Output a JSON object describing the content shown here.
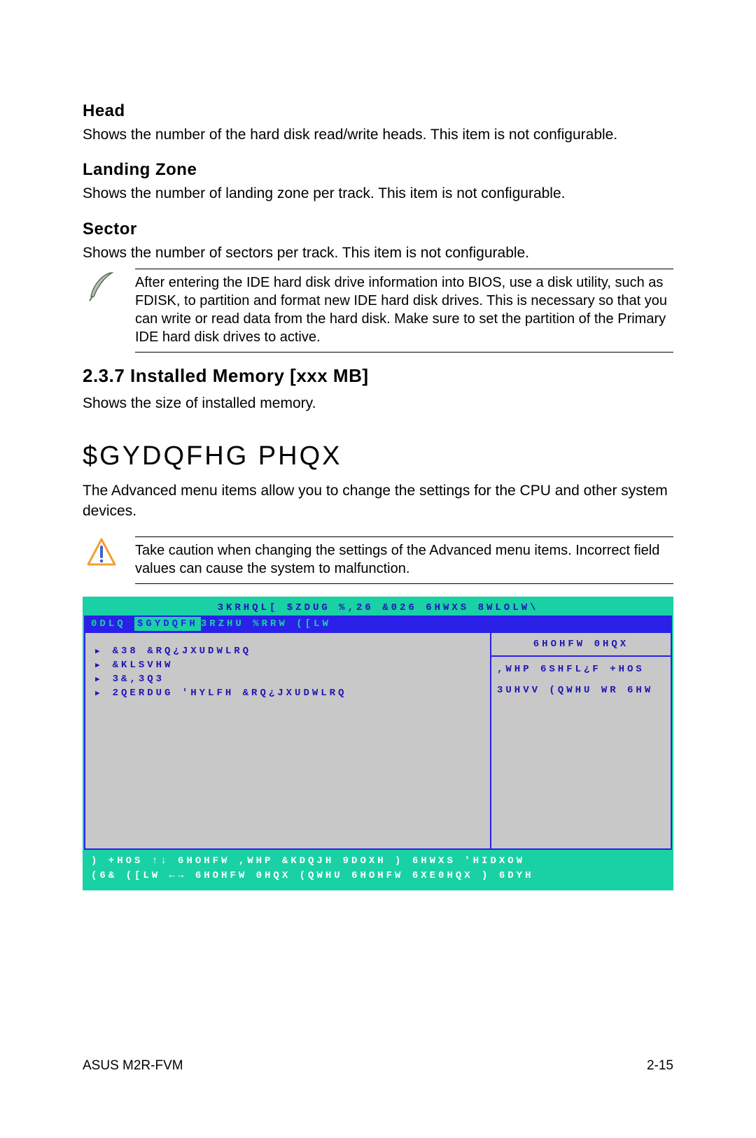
{
  "sections": {
    "head": {
      "title": "Head",
      "body": "Shows the number of the hard disk read/write heads. This item is not configurable."
    },
    "landing": {
      "title": "Landing Zone",
      "body": "Shows the number of landing zone per track. This item is not configurable."
    },
    "sector": {
      "title": "Sector",
      "body": "Shows the number of sectors per track. This item is not configurable."
    }
  },
  "note1": "After entering the IDE hard disk drive information into BIOS, use a disk utility, such as FDISK, to partition and format new IDE hard disk drives. This is necessary so that you can write or read data from the hard disk. Make sure to set the partition of the Primary IDE hard disk drives to active.",
  "memory": {
    "title": "2.3.7  Installed Memory [xxx MB]",
    "body": "Shows the size of installed memory."
  },
  "advanced": {
    "title": "$GYDQFHG PHQX",
    "body": "The Advanced menu items allow you to change the settings for the CPU and other system devices."
  },
  "note2": "Take caution when changing the settings of the Advanced menu items. Incorrect field values can cause the system to malfunction.",
  "bios": {
    "title": "3KRHQL[ $ZDUG %,26 &026 6HWXS 8WLOLW\\",
    "tab_left": "0DLQ",
    "tab_sel": "$GYDQFH",
    "tab_rest": "3RZHU   %RRW ([LW",
    "items": [
      "&38 &RQ¿JXUDWLRQ",
      "&KLSVHW",
      "3&,3Q3",
      "2QERDUG 'HYLFH &RQ¿JXUDWLRQ"
    ],
    "help_head": "6HOHFW 0HQX",
    "help_l1": ",WHP 6SHFL¿F +HOS",
    "help_l2": "3UHVV (QWHU WR 6HW",
    "foot_l1": ") +HOS ↑↓  6HOHFW ,WHP    &KDQJH 9DOXH    ) 6HWXS 'HIDXOW",
    "foot_l2": "(6& ([LW ←→  6HOHFW 0HQX    (QWHU 6HOHFW 6XE0HQX   ) 6DYH"
  },
  "footer": {
    "left": "ASUS M2R-FVM",
    "right": "2-15"
  }
}
